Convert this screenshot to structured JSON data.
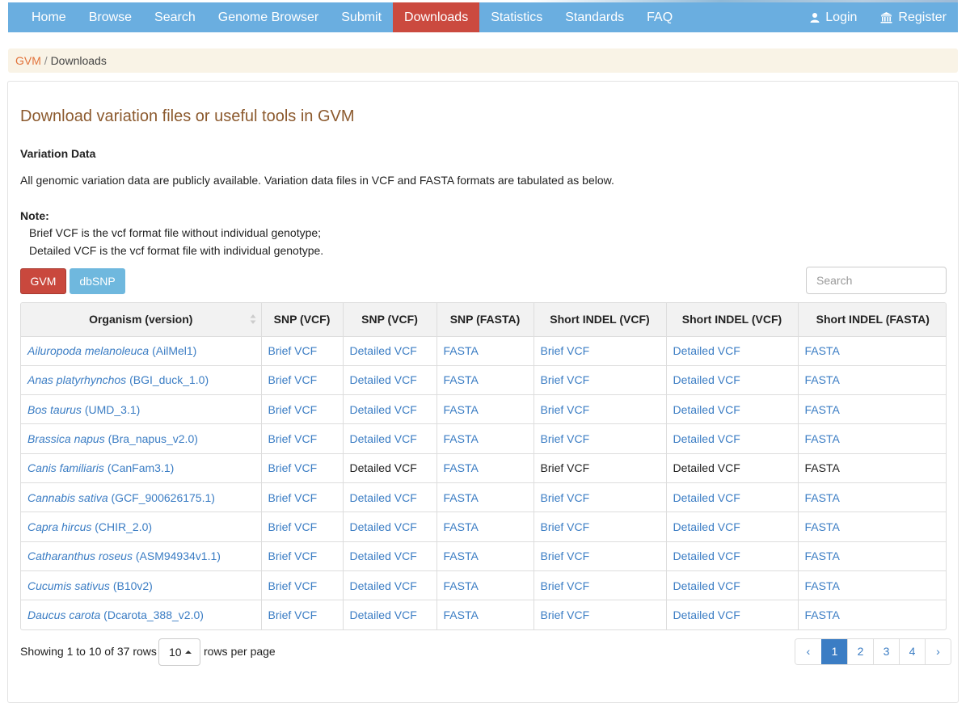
{
  "nav": {
    "left": [
      {
        "label": "Home"
      },
      {
        "label": "Browse"
      },
      {
        "label": "Search"
      },
      {
        "label": "Genome Browser"
      },
      {
        "label": "Submit"
      },
      {
        "label": "Downloads",
        "active": true
      },
      {
        "label": "Statistics"
      },
      {
        "label": "Standards"
      },
      {
        "label": "FAQ"
      }
    ],
    "login_label": "Login",
    "login_icon": "user-icon",
    "register_label": "Register",
    "register_icon": "institution-icon",
    "bar_color": "#6aaee0",
    "active_color": "#cb4a3f"
  },
  "breadcrumb": {
    "root": "GVM",
    "separator": "/",
    "current": "Downloads"
  },
  "main": {
    "title": "Download variation files or useful tools in GVM",
    "section_title": "Variation Data",
    "description": "All genomic variation data are publicly available. Variation data files in VCF and FASTA formats are tabulated as below.",
    "note_title": "Note:",
    "note_lines": [
      "Brief VCF is the vcf format file without individual genotype;",
      "Detailed VCF is the vcf format file with individual genotype."
    ],
    "buttons": {
      "gvm": "GVM",
      "dbsnp": "dbSNP"
    },
    "search_placeholder": "Search"
  },
  "table": {
    "headers": [
      "Organism (version)",
      "SNP (VCF)",
      "SNP (VCF)",
      "SNP (FASTA)",
      "Short INDEL (VCF)",
      "Short INDEL (VCF)",
      "Short INDEL (FASTA)"
    ],
    "rows": [
      {
        "species": "Ailuropoda melanoleuca",
        "version": "(AilMel1)",
        "cells": [
          "Brief VCF",
          "Detailed VCF",
          "FASTA",
          "Brief VCF",
          "Detailed VCF",
          "FASTA"
        ],
        "links": [
          true,
          true,
          true,
          true,
          true,
          true
        ]
      },
      {
        "species": "Anas platyrhynchos",
        "version": "(BGI_duck_1.0)",
        "cells": [
          "Brief VCF",
          "Detailed VCF",
          "FASTA",
          "Brief VCF",
          "Detailed VCF",
          "FASTA"
        ],
        "links": [
          true,
          true,
          true,
          true,
          true,
          true
        ]
      },
      {
        "species": "Bos taurus",
        "version": "(UMD_3.1)",
        "cells": [
          "Brief VCF",
          "Detailed VCF",
          "FASTA",
          "Brief VCF",
          "Detailed VCF",
          "FASTA"
        ],
        "links": [
          true,
          true,
          true,
          true,
          true,
          true
        ]
      },
      {
        "species": "Brassica napus",
        "version": "(Bra_napus_v2.0)",
        "cells": [
          "Brief VCF",
          "Detailed VCF",
          "FASTA",
          "Brief VCF",
          "Detailed VCF",
          "FASTA"
        ],
        "links": [
          true,
          true,
          true,
          true,
          true,
          true
        ]
      },
      {
        "species": "Canis familiaris",
        "version": "(CanFam3.1)",
        "cells": [
          "Brief VCF",
          "Detailed VCF",
          "FASTA",
          "Brief VCF",
          "Detailed VCF",
          "FASTA"
        ],
        "links": [
          true,
          false,
          true,
          false,
          false,
          false
        ]
      },
      {
        "species": "Cannabis sativa",
        "version": "(GCF_900626175.1)",
        "cells": [
          "Brief VCF",
          "Detailed VCF",
          "FASTA",
          "Brief VCF",
          "Detailed VCF",
          "FASTA"
        ],
        "links": [
          true,
          true,
          true,
          true,
          true,
          true
        ]
      },
      {
        "species": "Capra hircus",
        "version": "(CHIR_2.0)",
        "cells": [
          "Brief VCF",
          "Detailed VCF",
          "FASTA",
          "Brief VCF",
          "Detailed VCF",
          "FASTA"
        ],
        "links": [
          true,
          true,
          true,
          true,
          true,
          true
        ]
      },
      {
        "species": "Catharanthus roseus",
        "version": "(ASM94934v1.1)",
        "cells": [
          "Brief VCF",
          "Detailed VCF",
          "FASTA",
          "Brief VCF",
          "Detailed VCF",
          "FASTA"
        ],
        "links": [
          true,
          true,
          true,
          true,
          true,
          true
        ]
      },
      {
        "species": "Cucumis sativus",
        "version": "(B10v2)",
        "cells": [
          "Brief VCF",
          "Detailed VCF",
          "FASTA",
          "Brief VCF",
          "Detailed VCF",
          "FASTA"
        ],
        "links": [
          true,
          true,
          true,
          true,
          true,
          true
        ]
      },
      {
        "species": "Daucus carota",
        "version": "(Dcarota_388_v2.0)",
        "cells": [
          "Brief VCF",
          "Detailed VCF",
          "FASTA",
          "Brief VCF",
          "Detailed VCF",
          "FASTA"
        ],
        "links": [
          true,
          true,
          true,
          true,
          true,
          true
        ]
      }
    ],
    "link_color": "#3b7dc4"
  },
  "footer": {
    "showing_text": "Showing 1 to 10 of 37 rows",
    "rows_per_page_value": "10",
    "rows_per_page_label": "rows per page",
    "pages": [
      "‹",
      "1",
      "2",
      "3",
      "4",
      "›"
    ],
    "active_page": "1"
  }
}
